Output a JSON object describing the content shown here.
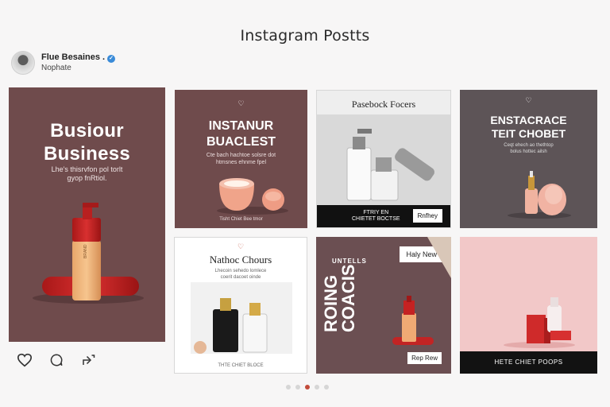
{
  "page": {
    "title": "Instagram Postts"
  },
  "profile": {
    "name": "Flue Besaines .",
    "subtitle": "Nophate"
  },
  "posts": {
    "main": {
      "title_line1": "Busiour",
      "title_line2": "Business",
      "subtitle": "Lhe's thisrvfon pol torlt\ngyop fnRtiol."
    },
    "tile1": {
      "title_line1": "INSTANUR",
      "title_line2": "BUACLEST",
      "subtitle": "Cte bach hachtoe solsre dot\nhtmsnes ehnme fpel",
      "footer": "Tisht Chiet Bee tmor"
    },
    "tile2": {
      "title": "Pasebock Focers",
      "bar_text": "FTRIY EN\nCHIETET BOCTSE",
      "button": "Rnfhey"
    },
    "tile3": {
      "title_line1": "ENSTACRACE",
      "title_line2": "TEIT CHOBET",
      "subtitle": "Ceqt ehech ao thethtop\nbolus hottec ailsh"
    },
    "tile4": {
      "title": "Nathoc Chours",
      "subtitle": "Lhecoin sehedo lomlece\ncoerit dacoet oinde",
      "footer": "THTE CHIET BLOCE"
    },
    "tile5": {
      "label_top": "UNTELLS",
      "vertical_text": "ROING\nCOACIS",
      "badge_top": "Haly New",
      "badge_bottom": "Rep Rew"
    },
    "tile6": {
      "bar_text": "HETE CHIET POOPS"
    }
  },
  "actions": {
    "like_icon": "heart-icon",
    "comment_icon": "comment-icon",
    "share_icon": "share-icon"
  },
  "carousel": {
    "total": 5,
    "active": 3
  },
  "colors": {
    "mauve": "#6f4b4c",
    "dark_plum": "#5d5457",
    "pink": "#f2c8c8",
    "accent": "#c24b3a"
  }
}
